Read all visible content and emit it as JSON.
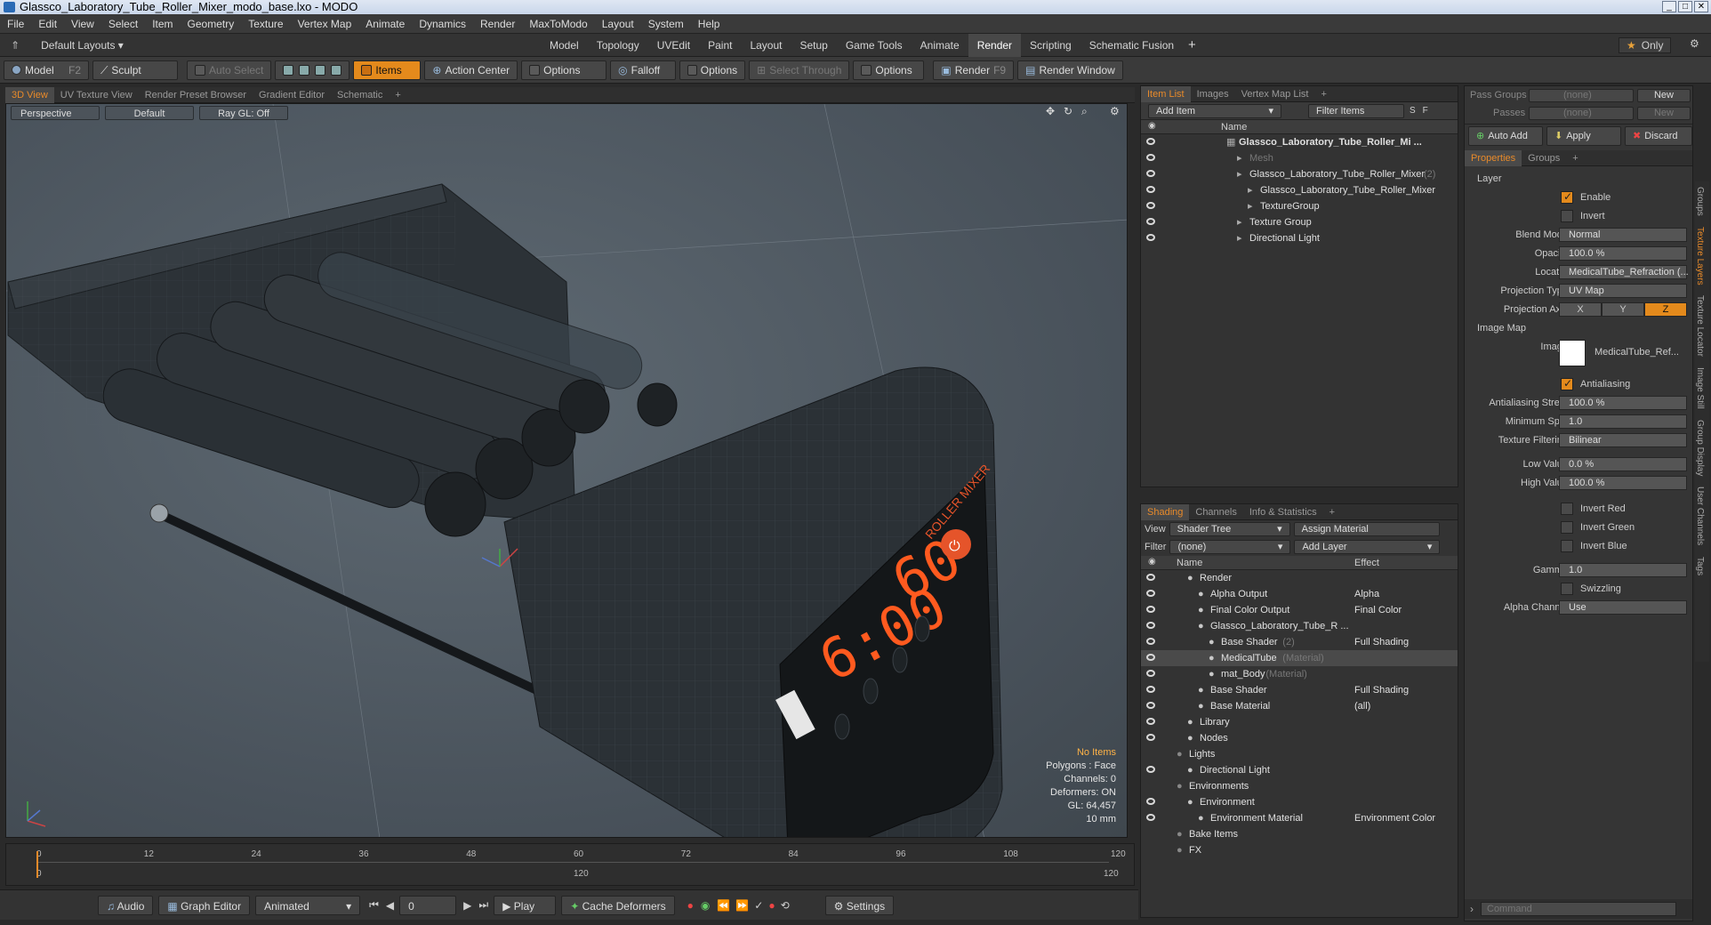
{
  "window": {
    "title": "Glassco_Laboratory_Tube_Roller_Mixer_modo_base.lxo - MODO"
  },
  "menu": [
    "File",
    "Edit",
    "View",
    "Select",
    "Item",
    "Geometry",
    "Texture",
    "Vertex Map",
    "Animate",
    "Dynamics",
    "Render",
    "MaxToModo",
    "Layout",
    "System",
    "Help"
  ],
  "layout": {
    "preset": "Default Layouts ▾",
    "tabs": [
      "Model",
      "Topology",
      "UVEdit",
      "Paint",
      "Layout",
      "Setup",
      "Game Tools",
      "Animate",
      "Render",
      "Scripting",
      "Schematic Fusion"
    ],
    "active_tab": "Render",
    "only_label": "Only"
  },
  "toolbar": {
    "model": "Model",
    "model_key": "F2",
    "sculpt": "Sculpt",
    "auto_select": "Auto Select",
    "items": "Items",
    "action_center": "Action Center",
    "options1": "Options",
    "falloff": "Falloff",
    "options2": "Options",
    "select_through": "Select Through",
    "options3": "Options",
    "render": "Render",
    "render_key": "F9",
    "render_window": "Render Window"
  },
  "viewport": {
    "tabs": [
      "3D View",
      "UV Texture View",
      "Render Preset Browser",
      "Gradient Editor",
      "Schematic"
    ],
    "active": "3D View",
    "perspective": "Perspective",
    "default": "Default",
    "raygl": "Ray GL: Off",
    "hud": {
      "no_items": "No Items",
      "polygons": "Polygons : Face",
      "channels": "Channels: 0",
      "deformers": "Deformers: ON",
      "gl": "GL: 64,457",
      "scale": "10 mm"
    },
    "device": {
      "brand": "ROLLER MIXER",
      "time": "6:00",
      "speed": "60"
    }
  },
  "timeline": {
    "ticks": [
      "0",
      "12",
      "24",
      "36",
      "48",
      "60",
      "72",
      "84",
      "96",
      "108",
      "120"
    ],
    "sub_ticks": [
      "0",
      "120",
      "120"
    ]
  },
  "bottom": {
    "audio": "Audio",
    "graph_editor": "Graph Editor",
    "animated": "Animated",
    "frame": "0",
    "play": "Play",
    "cache": "Cache Deformers",
    "settings": "Settings"
  },
  "item_list": {
    "tabs": [
      "Item List",
      "Images",
      "Vertex Map List"
    ],
    "add_item": "Add Item",
    "filter": "Filter Items",
    "col_name": "Name",
    "rows": [
      {
        "label": "Glassco_Laboratory_Tube_Roller_Mi ...",
        "indent": 0,
        "bold": true
      },
      {
        "label": "Mesh",
        "indent": 1,
        "hint": true
      },
      {
        "label": "Glassco_Laboratory_Tube_Roller_Mixer",
        "suffix": "(2)",
        "indent": 1
      },
      {
        "label": "Glassco_Laboratory_Tube_Roller_Mixer",
        "indent": 2
      },
      {
        "label": "TextureGroup",
        "indent": 2
      },
      {
        "label": "Texture Group",
        "indent": 1
      },
      {
        "label": "Directional Light",
        "indent": 1
      }
    ]
  },
  "shading": {
    "tabs": [
      "Shading",
      "Channels",
      "Info & Statistics"
    ],
    "view_label": "View",
    "view": "Shader Tree",
    "assign": "Assign Material",
    "filter_label": "Filter",
    "filter": "(none)",
    "add_layer": "Add Layer",
    "col_name": "Name",
    "col_effect": "Effect",
    "rows": [
      {
        "label": "Render",
        "effect": "",
        "indent": 0
      },
      {
        "label": "Alpha Output",
        "effect": "Alpha",
        "indent": 1
      },
      {
        "label": "Final Color Output",
        "effect": "Final Color",
        "indent": 1
      },
      {
        "label": "Glassco_Laboratory_Tube_R ...",
        "effect": "",
        "indent": 1
      },
      {
        "label": "Base Shader",
        "suffix": "(2)",
        "effect": "Full Shading",
        "indent": 2
      },
      {
        "label": "MedicalTube",
        "suffix": "(Material)",
        "effect": "",
        "indent": 2,
        "sel": true
      },
      {
        "label": "mat_Body",
        "suffix": "(Material)",
        "effect": "",
        "indent": 2
      },
      {
        "label": "Base Shader",
        "effect": "Full Shading",
        "indent": 1
      },
      {
        "label": "Base Material",
        "effect": "(all)",
        "indent": 1
      },
      {
        "label": "Library",
        "effect": "",
        "indent": 0
      },
      {
        "label": "Nodes",
        "effect": "",
        "indent": 0
      },
      {
        "label": "Lights",
        "effect": "",
        "indent": -1
      },
      {
        "label": "Directional Light",
        "effect": "",
        "indent": 0
      },
      {
        "label": "Environments",
        "effect": "",
        "indent": -1
      },
      {
        "label": "Environment",
        "effect": "",
        "indent": 0
      },
      {
        "label": "Environment Material",
        "effect": "Environment Color",
        "indent": 1
      },
      {
        "label": "Bake Items",
        "effect": "",
        "indent": -1
      },
      {
        "label": "FX",
        "effect": "",
        "indent": -1
      }
    ]
  },
  "props": {
    "pass_groups": "Pass Groups",
    "pass_value": "(none)",
    "new": "New",
    "passes": "Passes",
    "passes_value": "(none)",
    "new2": "New",
    "auto_add": "Auto Add",
    "apply": "Apply",
    "discard": "Discard",
    "tabs": [
      "Properties",
      "Groups"
    ],
    "section": "Layer",
    "enable": "Enable",
    "invert": "Invert",
    "blend_mode_label": "Blend Mode",
    "blend_mode": "Normal",
    "opacity_label": "Opacity",
    "opacity": "100.0 %",
    "locator_label": "Locator",
    "locator": "MedicalTube_Refraction (...",
    "proj_type_label": "Projection Type",
    "proj_type": "UV Map",
    "proj_axis_label": "Projection Axis",
    "axes": [
      "X",
      "Y",
      "Z"
    ],
    "image_map": "Image Map",
    "image_label": "Image",
    "image": "MedicalTube_Ref...",
    "antialiasing": "Antialiasing",
    "aa_str_label": "Antialiasing Stre...",
    "aa_str": "100.0 %",
    "min_spot_label": "Minimum Spot",
    "min_spot": "1.0",
    "tex_filter_label": "Texture Filtering",
    "tex_filter": "Bilinear",
    "low_label": "Low Value",
    "low": "0.0 %",
    "high_label": "High Value",
    "high": "100.0 %",
    "inv_red": "Invert Red",
    "inv_green": "Invert Green",
    "inv_blue": "Invert Blue",
    "gamma_label": "Gamma",
    "gamma": "1.0",
    "swizzling": "Swizzling",
    "alpha_channel_label": "Alpha Channel",
    "alpha_channel": "Use",
    "command_placeholder": "Command"
  },
  "side_tabs": [
    "Groups",
    "Texture Layers",
    "Texture Locator",
    "Image Still",
    "Group Display",
    "User Channels",
    "Tags"
  ]
}
